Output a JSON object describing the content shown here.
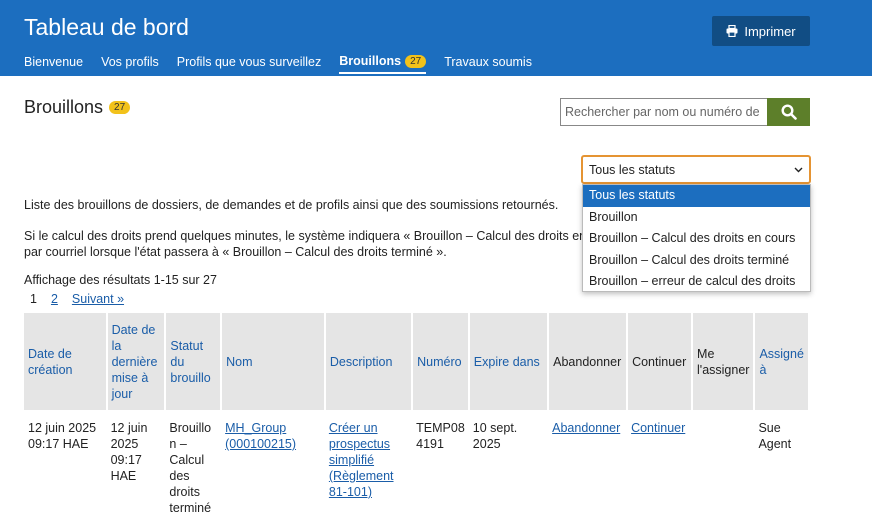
{
  "header": {
    "title": "Tableau de bord",
    "tabs": [
      {
        "label": "Bienvenue"
      },
      {
        "label": "Vos profils"
      },
      {
        "label": "Profils que vous surveillez"
      },
      {
        "label": "Brouillons",
        "badge": "27",
        "active": true
      },
      {
        "label": "Travaux soumis"
      }
    ],
    "print_label": "Imprimer"
  },
  "page": {
    "title": "Brouillons",
    "badge": "27",
    "search_placeholder": "Rechercher par nom ou numéro de p",
    "status_select": "Tous les statuts",
    "status_options": [
      "Tous les statuts",
      "Brouillon",
      "Brouillon – Calcul des droits en cours",
      "Brouillon – Calcul des droits terminé",
      "Brouillon – erreur de calcul des droits"
    ],
    "desc1": "Liste des brouillons de dossiers, de demandes et de profils ainsi que des soumissions retournés.",
    "desc2_line1": "Si le calcul des droits prend quelques minutes, le système indiquera « Brouillon – Calcul des droits en cours »",
    "desc2_line2": "par courriel lorsque l'état passera à « Brouillon – Calcul des droits terminé ».",
    "results": "Affichage des résultats 1-15 sur 27",
    "pager": {
      "current": "1",
      "page2": "2",
      "next": "Suivant »"
    }
  },
  "table": {
    "columns": [
      "Date de création",
      "Date de la dernière mise à jour",
      "Statut du brouillo",
      "Nom",
      "Description",
      "Numéro",
      "Expire dans",
      "Abandonner",
      "Continuer",
      "Me l'assigner",
      "Assigné à"
    ],
    "rows": [
      {
        "created": "12 juin 2025 09:17 HAE",
        "updated": "12 juin 2025 09:17 HAE",
        "status": "Brouillo n – Calcul des droits terminé",
        "name": "MH_Group (000100215)",
        "description": "Créer un prospectus simplifié (Règlement 81-101)",
        "number": "TEMP08 4191",
        "expires": "10 sept. 2025",
        "abandon": "Abandonner",
        "continue": "Continuer",
        "assign": "",
        "assigned_to": "Sue Agent"
      }
    ]
  }
}
